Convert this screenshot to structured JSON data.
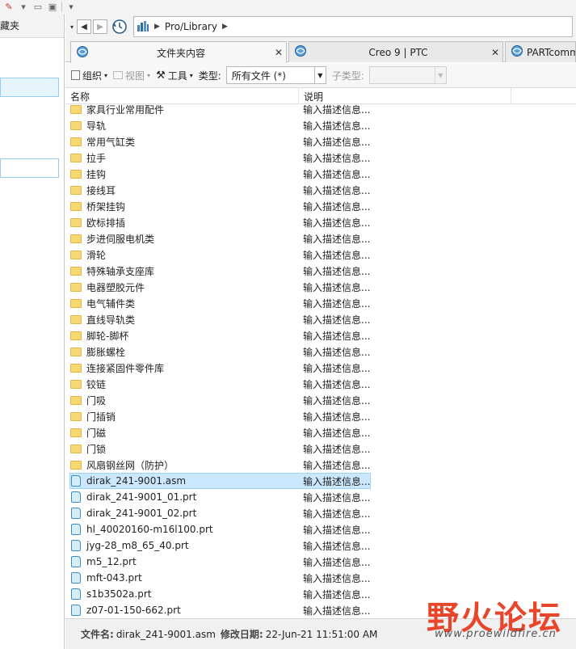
{
  "left_pane": {
    "header": "藏夹"
  },
  "address": {
    "crumb": "Pro/Library"
  },
  "tabs": [
    {
      "label": "文件夹内容",
      "active": true
    },
    {
      "label": "Creo 9 | PTC",
      "active": false
    },
    {
      "label": "PARTcomm",
      "active": false
    }
  ],
  "commands": {
    "organize": "组织",
    "views": "视图",
    "tools": "工具",
    "type_label": "类型:",
    "type_value": "所有文件 (*)",
    "subtype_label": "子类型:",
    "subtype_value": ""
  },
  "columns": {
    "name": "名称",
    "desc": "说明"
  },
  "files": [
    {
      "name": "家具行业常用配件",
      "kind": "folder",
      "desc": "输入描述信息..."
    },
    {
      "name": "导轨",
      "kind": "folder",
      "desc": "输入描述信息..."
    },
    {
      "name": "常用气缸类",
      "kind": "folder",
      "desc": "输入描述信息..."
    },
    {
      "name": "拉手",
      "kind": "folder",
      "desc": "输入描述信息..."
    },
    {
      "name": "挂钩",
      "kind": "folder",
      "desc": "输入描述信息..."
    },
    {
      "name": "接线耳",
      "kind": "folder",
      "desc": "输入描述信息..."
    },
    {
      "name": "桥架挂钩",
      "kind": "folder",
      "desc": "输入描述信息..."
    },
    {
      "name": "欧标排插",
      "kind": "folder",
      "desc": "输入描述信息..."
    },
    {
      "name": "步进伺服电机类",
      "kind": "folder",
      "desc": "输入描述信息..."
    },
    {
      "name": "滑轮",
      "kind": "folder",
      "desc": "输入描述信息..."
    },
    {
      "name": "特殊轴承支座库",
      "kind": "folder",
      "desc": "输入描述信息..."
    },
    {
      "name": "电器塑胶元件",
      "kind": "folder",
      "desc": "输入描述信息..."
    },
    {
      "name": "电气辅件类",
      "kind": "folder",
      "desc": "输入描述信息..."
    },
    {
      "name": "直线导轨类",
      "kind": "folder",
      "desc": "输入描述信息..."
    },
    {
      "name": "脚轮-脚杯",
      "kind": "folder",
      "desc": "输入描述信息..."
    },
    {
      "name": "膨胀螺栓",
      "kind": "folder",
      "desc": "输入描述信息..."
    },
    {
      "name": "连接紧固件零件库",
      "kind": "folder",
      "desc": "输入描述信息..."
    },
    {
      "name": "铰链",
      "kind": "folder",
      "desc": "输入描述信息..."
    },
    {
      "name": "门吸",
      "kind": "folder",
      "desc": "输入描述信息..."
    },
    {
      "name": "门插销",
      "kind": "folder",
      "desc": "输入描述信息..."
    },
    {
      "name": "门磁",
      "kind": "folder",
      "desc": "输入描述信息..."
    },
    {
      "name": "门锁",
      "kind": "folder",
      "desc": "输入描述信息..."
    },
    {
      "name": "风扇钢丝网（防护）",
      "kind": "folder",
      "desc": "输入描述信息..."
    },
    {
      "name": "dirak_241-9001.asm",
      "kind": "file",
      "desc": "输入描述信息...",
      "selected": true
    },
    {
      "name": "dirak_241-9001_01.prt",
      "kind": "file",
      "desc": "输入描述信息..."
    },
    {
      "name": "dirak_241-9001_02.prt",
      "kind": "file",
      "desc": "输入描述信息..."
    },
    {
      "name": "hl_40020160-m16l100.prt",
      "kind": "file",
      "desc": "输入描述信息..."
    },
    {
      "name": "jyg-28_m8_65_40.prt",
      "kind": "file",
      "desc": "输入描述信息..."
    },
    {
      "name": "m5_12.prt",
      "kind": "file",
      "desc": "输入描述信息..."
    },
    {
      "name": "mft-043.prt",
      "kind": "file",
      "desc": "输入描述信息..."
    },
    {
      "name": "s1b3502a.prt",
      "kind": "file",
      "desc": "输入描述信息..."
    },
    {
      "name": "z07-01-150-662.prt",
      "kind": "file",
      "desc": "输入描述信息..."
    }
  ],
  "status": {
    "filename_label": "文件名:",
    "filename_value": "dirak_241-9001.asm",
    "modified_label": "修改日期:",
    "modified_value": "22-Jun-21 11:51:00 AM"
  },
  "watermark": {
    "text": "野火论坛",
    "url": "www.proewildfire.cn"
  }
}
